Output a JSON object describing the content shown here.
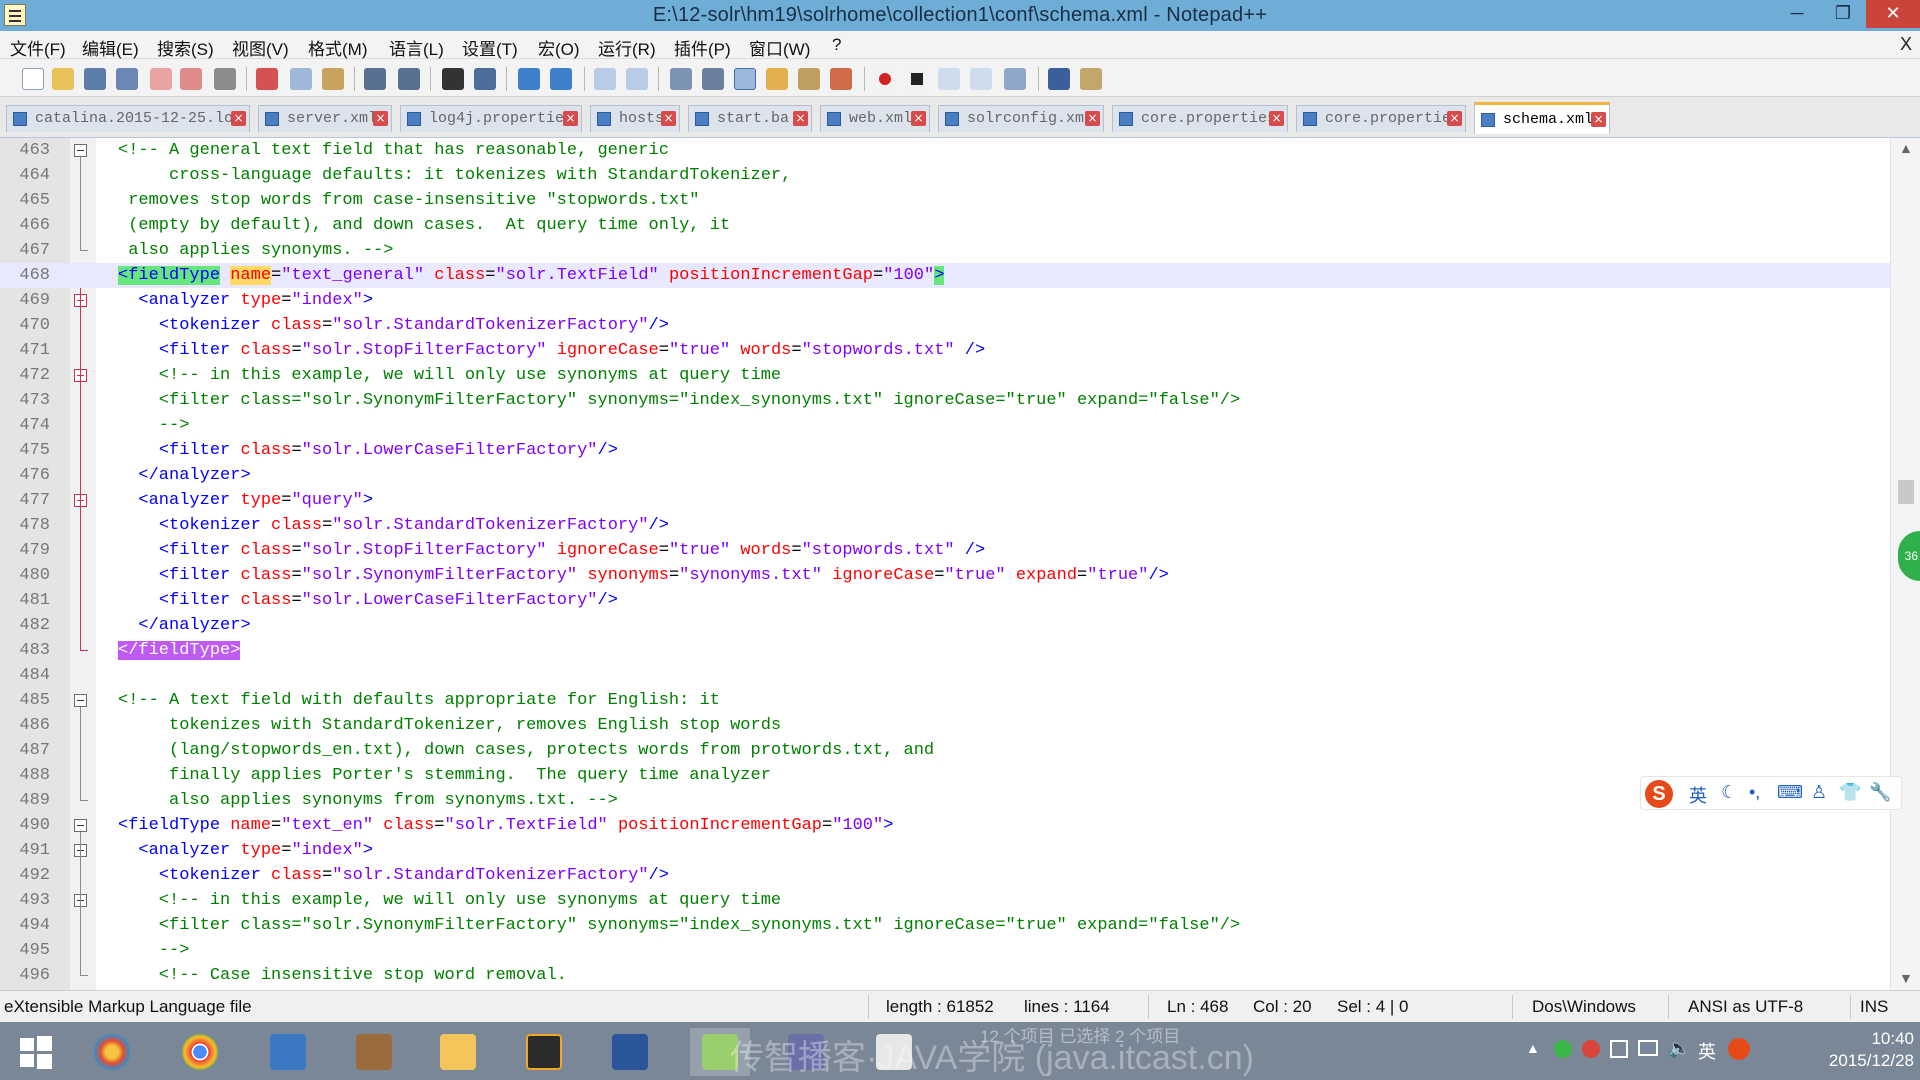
{
  "window": {
    "title": "E:\\12-solr\\hm19\\solrhome\\collection1\\conf\\schema.xml - Notepad++",
    "minimize_glyph": "─",
    "maximize_glyph": "❐",
    "close_glyph": "✕"
  },
  "menu": {
    "items": [
      "文件(F)",
      "编辑(E)",
      "搜索(S)",
      "视图(V)",
      "格式(M)",
      "语言(L)",
      "设置(T)",
      "宏(O)",
      "运行(R)",
      "插件(P)",
      "窗口(W)",
      "?"
    ],
    "doc_close": "X"
  },
  "toolbar": {
    "icons": [
      "new-file",
      "open-file",
      "save",
      "save-all",
      "close",
      "close-all",
      "print",
      "cut",
      "copy",
      "paste",
      "undo",
      "redo",
      "find",
      "replace",
      "zoom-in",
      "zoom-out",
      "sync-vertical",
      "sync-horizontal",
      "word-wrap",
      "show-all-characters",
      "indent-guide",
      "user-defined-language",
      "doc-map",
      "record-macro",
      "stop-recording",
      "play-macro",
      "run-macro-multiple",
      "save-macro",
      "spell-check",
      "launch-browser"
    ]
  },
  "tabs": [
    {
      "label": "catalina.2015-12-25.lo",
      "active": false
    },
    {
      "label": "server.xml",
      "active": false
    },
    {
      "label": "log4j.properties",
      "active": false
    },
    {
      "label": "hosts",
      "active": false
    },
    {
      "label": "start.ba",
      "active": false
    },
    {
      "label": "web.xml",
      "active": false
    },
    {
      "label": "solrconfig.xml",
      "active": false
    },
    {
      "label": "core.properties",
      "active": false
    },
    {
      "label": "core.propertie",
      "active": false
    },
    {
      "label": "schema.xml",
      "active": true
    }
  ],
  "editor": {
    "current_line": 468,
    "lines": [
      {
        "n": "463",
        "text": "<!-- A general text field that has reasonable, generic"
      },
      {
        "n": "464",
        "text": "     cross-language defaults: it tokenizes with StandardTokenizer,"
      },
      {
        "n": "465",
        "text": " removes stop words from case-insensitive \"stopwords.txt\""
      },
      {
        "n": "466",
        "text": " (empty by default), and down cases.  At query time only, it"
      },
      {
        "n": "467",
        "text": " also applies synonyms. -->"
      },
      {
        "n": "468",
        "text": "<fieldType name=\"text_general\" class=\"solr.TextField\" positionIncrementGap=\"100\">"
      },
      {
        "n": "469",
        "text": "  <analyzer type=\"index\">"
      },
      {
        "n": "470",
        "text": "    <tokenizer class=\"solr.StandardTokenizerFactory\"/>"
      },
      {
        "n": "471",
        "text": "    <filter class=\"solr.StopFilterFactory\" ignoreCase=\"true\" words=\"stopwords.txt\" />"
      },
      {
        "n": "472",
        "text": "    <!-- in this example, we will only use synonyms at query time"
      },
      {
        "n": "473",
        "text": "    <filter class=\"solr.SynonymFilterFactory\" synonyms=\"index_synonyms.txt\" ignoreCase=\"true\" expand=\"false\"/>"
      },
      {
        "n": "474",
        "text": "    -->"
      },
      {
        "n": "475",
        "text": "    <filter class=\"solr.LowerCaseFilterFactory\"/>"
      },
      {
        "n": "476",
        "text": "  </analyzer>"
      },
      {
        "n": "477",
        "text": "  <analyzer type=\"query\">"
      },
      {
        "n": "478",
        "text": "    <tokenizer class=\"solr.StandardTokenizerFactory\"/>"
      },
      {
        "n": "479",
        "text": "    <filter class=\"solr.StopFilterFactory\" ignoreCase=\"true\" words=\"stopwords.txt\" />"
      },
      {
        "n": "480",
        "text": "    <filter class=\"solr.SynonymFilterFactory\" synonyms=\"synonyms.txt\" ignoreCase=\"true\" expand=\"true\"/>"
      },
      {
        "n": "481",
        "text": "    <filter class=\"solr.LowerCaseFilterFactory\"/>"
      },
      {
        "n": "482",
        "text": "  </analyzer>"
      },
      {
        "n": "483",
        "text": "</fieldType>"
      },
      {
        "n": "484",
        "text": ""
      },
      {
        "n": "485",
        "text": "<!-- A text field with defaults appropriate for English: it"
      },
      {
        "n": "486",
        "text": "     tokenizes with StandardTokenizer, removes English stop words"
      },
      {
        "n": "487",
        "text": "     (lang/stopwords_en.txt), down cases, protects words from protwords.txt, and"
      },
      {
        "n": "488",
        "text": "     finally applies Porter's stemming.  The query time analyzer"
      },
      {
        "n": "489",
        "text": "     also applies synonyms from synonyms.txt. -->"
      },
      {
        "n": "490",
        "text": "<fieldType name=\"text_en\" class=\"solr.TextField\" positionIncrementGap=\"100\">"
      },
      {
        "n": "491",
        "text": "  <analyzer type=\"index\">"
      },
      {
        "n": "492",
        "text": "    <tokenizer class=\"solr.StandardTokenizerFactory\"/>"
      },
      {
        "n": "493",
        "text": "    <!-- in this example, we will only use synonyms at query time"
      },
      {
        "n": "494",
        "text": "    <filter class=\"solr.SynonymFilterFactory\" synonyms=\"index_synonyms.txt\" ignoreCase=\"true\" expand=\"false\"/>"
      },
      {
        "n": "495",
        "text": "    -->"
      },
      {
        "n": "496",
        "text": "    <!-- Case insensitive stop word removal."
      }
    ],
    "side_badge": "36"
  },
  "ime": {
    "logo": "S",
    "items": [
      "英",
      "☾",
      "•,",
      "⌨",
      "♙",
      "👕",
      "🔧"
    ]
  },
  "statusbar": {
    "file_type": "eXtensible Markup Language file",
    "length": "length : 61852",
    "lines": "lines : 1164",
    "ln": "Ln : 468",
    "col": "Col : 20",
    "sel": "Sel : 4 | 0",
    "eol": "Dos\\Windows",
    "encoding": "ANSI as UTF-8",
    "mode": "INS"
  },
  "taskbar": {
    "apps": [
      "start",
      "photo-app",
      "chrome",
      "remote-desktop",
      "archive-app",
      "file-explorer",
      "sublime-text",
      "word",
      "notepad-plus-plus",
      "media-app",
      "java-app"
    ],
    "overlay_text_1": "12 个项目    已选择 2 个项目",
    "overlay_text_2": "传智播客·JAVA学院 (java.itcast.cn)",
    "tray_ime": "英",
    "clock_time": "10:40",
    "clock_date": "2015/12/28"
  },
  "colors": {
    "comment": "#008000",
    "tag": "#0000ff",
    "attribute": "#ff0000",
    "value": "#8000ff",
    "title_bar": "#6eaed6",
    "current_line": "#e8e8ff",
    "active_tab_accent": "#f8b242"
  }
}
